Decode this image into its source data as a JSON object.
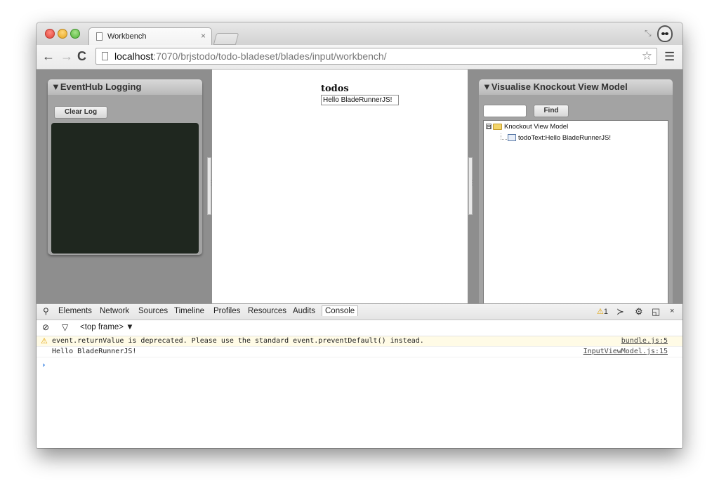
{
  "browser": {
    "tab_title": "Workbench",
    "tab_close": "×",
    "url_host": "localhost",
    "url_path": ":7070/brjstodo/todo-bladeset/blades/input/workbench/"
  },
  "left_panel": {
    "title": "▼EventHub Logging",
    "clear_button": "Clear Log"
  },
  "center": {
    "title": "todos",
    "input_value": "Hello BladeRunnerJS!"
  },
  "right_panel": {
    "title": "▼Visualise Knockout View Model",
    "find_button": "Find",
    "find_value": "",
    "tree_root": "Knockout View Model",
    "tree_root_toggle": "⊟",
    "tree_child": "todoText:Hello BladeRunnerJS!"
  },
  "devtools": {
    "tabs": [
      "Elements",
      "Network",
      "Sources",
      "Timeline",
      "Profiles",
      "Resources",
      "Audits",
      "Console"
    ],
    "active_tab": "Console",
    "warning_count": "1",
    "frame_selector": "<top frame> ▼",
    "console": [
      {
        "level": "warning",
        "message": "event.returnValue is deprecated. Please use the standard event.preventDefault() instead.",
        "source": "bundle.js:5"
      },
      {
        "level": "log",
        "message": "Hello BladeRunnerJS!",
        "source": "InputViewModel.js:15"
      }
    ],
    "prompt": "›"
  },
  "icons": {
    "back": "arrow-left",
    "forward": "arrow-right",
    "reload": "reload",
    "star": "star",
    "menu": "hamburger",
    "search": "magnifier",
    "filter": "funnel",
    "clear": "no-entry",
    "settings": "gear",
    "dock": "dock",
    "close": "x"
  },
  "colors": {
    "log_background": "#1f271f",
    "panel_background": "#a3a3a3",
    "page_background": "#8e8e8e",
    "warning": "#e0a000"
  }
}
